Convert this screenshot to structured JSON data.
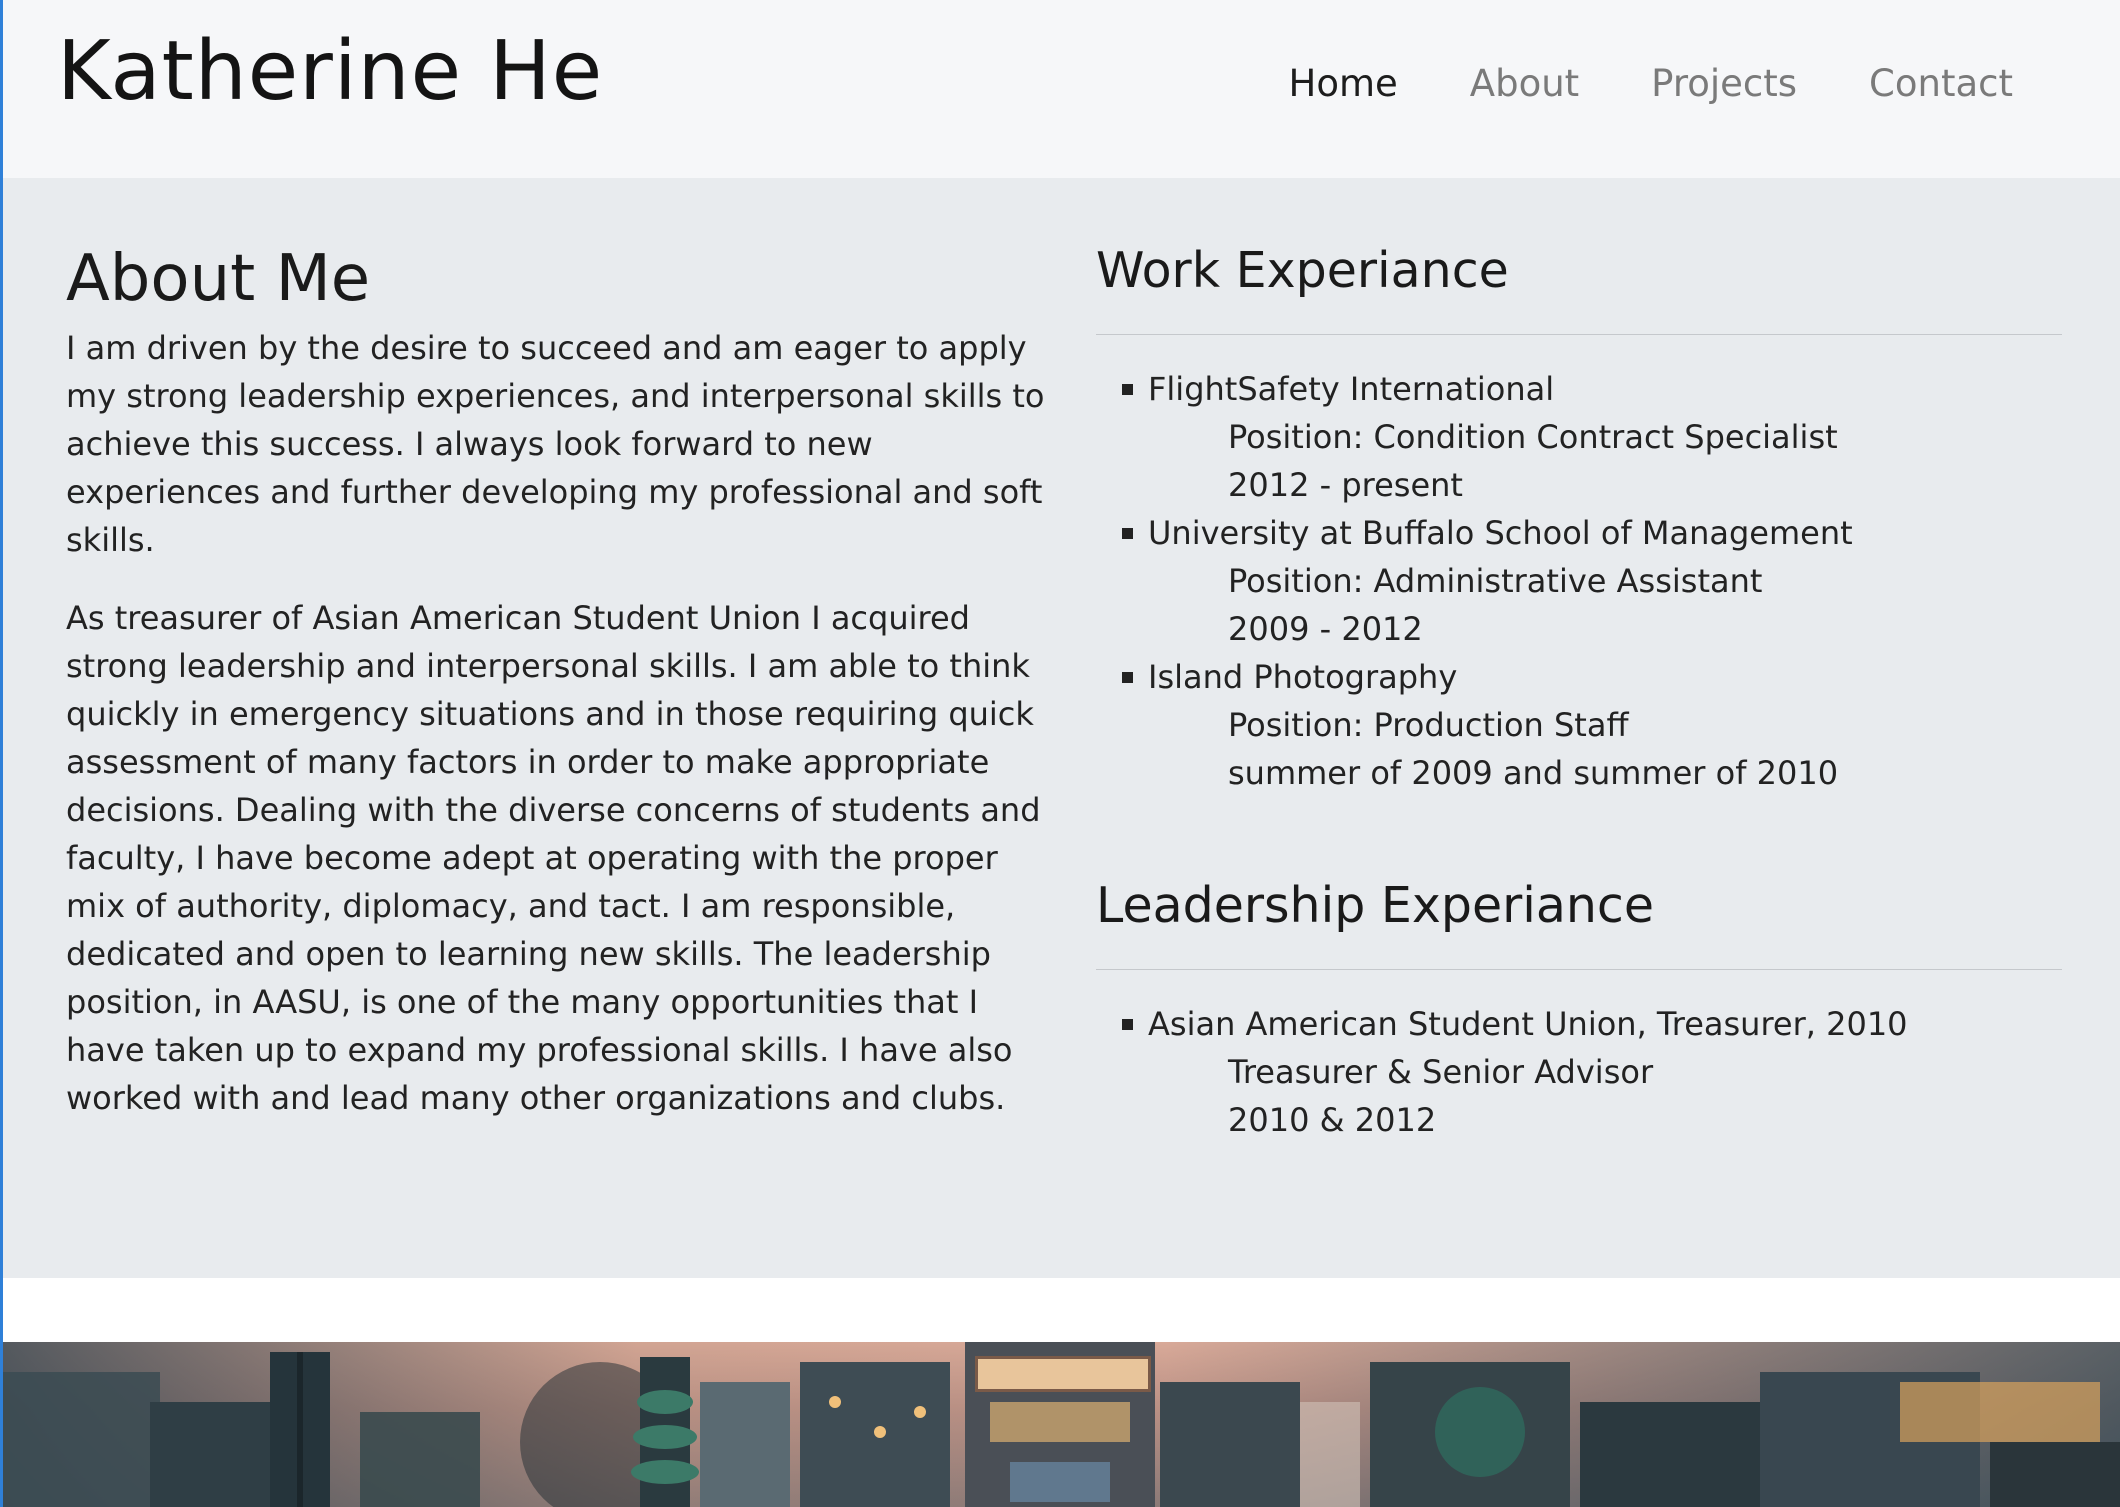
{
  "header": {
    "site_title": "Katherine He",
    "nav": [
      {
        "label": "Home",
        "active": true
      },
      {
        "label": "About",
        "active": false
      },
      {
        "label": "Projects",
        "active": false
      },
      {
        "label": "Contact",
        "active": false
      }
    ]
  },
  "about": {
    "title": "About Me",
    "paragraphs": [
      "I am driven by the desire to succeed and am eager to apply my strong leadership experiences, and interpersonal skills to achieve this success. I always look forward to new experiences and further developing my professional and soft skills.",
      "As treasurer of Asian American Student Union I acquired strong leadership and interpersonal skills. I am able to think quickly in emergency situations and in those requiring quick assessment of many factors in order to make appropriate decisions. Dealing with the diverse concerns of students and faculty, I have become adept at operating with the proper mix of authority, diplomacy, and tact. I am responsible, dedicated and open to learning new skills. The leadership position, in AASU, is one of the many opportunities that I have taken up to expand my professional skills. I have also worked with and lead many other organizations and clubs."
    ]
  },
  "work": {
    "title": "Work Experiance",
    "items": [
      {
        "org": "FlightSafety International",
        "position": "Position: Condition Contract Specialist",
        "dates": "2012 - present"
      },
      {
        "org": "University at Buffalo School of Management",
        "position": "Position: Administrative Assistant",
        "dates": "2009 - 2012"
      },
      {
        "org": "Island Photography",
        "position": "Position: Production Staff",
        "dates": "summer of 2009 and summer of 2010"
      }
    ]
  },
  "leadership": {
    "title": "Leadership Experiance",
    "items": [
      {
        "org": "Asian American Student Union, Treasurer, 2010",
        "position": "Treasurer & Senior Advisor",
        "dates": "2010 & 2012"
      }
    ]
  },
  "colors": {
    "header_bg": "#f6f7f9",
    "main_bg": "#e8ebee",
    "nav_active": "#1d1d1d",
    "nav_inactive": "#7a7a7a",
    "left_edge_accent": "#2f80d8"
  }
}
